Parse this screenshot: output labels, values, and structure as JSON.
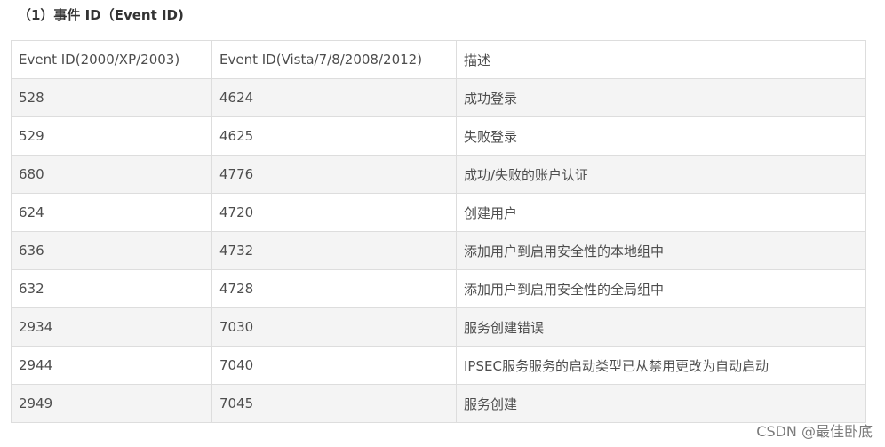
{
  "heading": "（1）事件 ID（Event ID)",
  "table": {
    "headers": [
      "Event ID(2000/XP/2003)",
      "Event ID(Vista/7/8/2008/2012)",
      "描述"
    ],
    "rows": [
      [
        "528",
        "4624",
        "成功登录"
      ],
      [
        "529",
        "4625",
        "失败登录"
      ],
      [
        "680",
        "4776",
        "成功/失败的账户认证"
      ],
      [
        "624",
        "4720",
        "创建用户"
      ],
      [
        "636",
        "4732",
        "添加用户到启用安全性的本地组中"
      ],
      [
        "632",
        "4728",
        "添加用户到启用安全性的全局组中"
      ],
      [
        "2934",
        "7030",
        "服务创建错误"
      ],
      [
        "2944",
        "7040",
        "IPSEC服务服务的启动类型已从禁用更改为自动启动"
      ],
      [
        "2949",
        "7045",
        "服务创建"
      ]
    ]
  },
  "watermark": "CSDN @最佳卧底",
  "colors": {
    "alt_row_bg": "#f4f4f4",
    "border": "#dddddd",
    "text": "#4d4d4d"
  }
}
